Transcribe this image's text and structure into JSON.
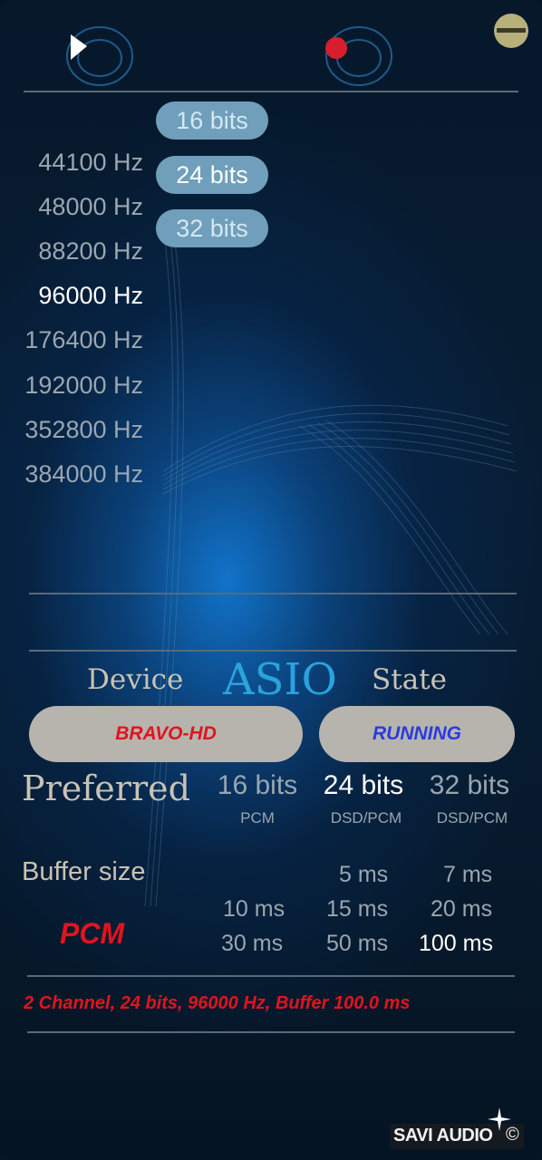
{
  "transport": {
    "play_icon": "play-icon",
    "record_icon": "record-icon",
    "minimize_icon": "minimize-icon"
  },
  "sample_rates": [
    {
      "label": "44100 Hz",
      "selected": false
    },
    {
      "label": "48000 Hz",
      "selected": false
    },
    {
      "label": "88200 Hz",
      "selected": false
    },
    {
      "label": "96000 Hz",
      "selected": true
    },
    {
      "label": "176400 Hz",
      "selected": false
    },
    {
      "label": "192000 Hz",
      "selected": false
    },
    {
      "label": "352800 Hz",
      "selected": false
    },
    {
      "label": "384000 Hz",
      "selected": false
    }
  ],
  "bit_depths": [
    {
      "label": "16 bits",
      "selected": false
    },
    {
      "label": "24 bits",
      "selected": true
    },
    {
      "label": "32 bits",
      "selected": false
    }
  ],
  "device": {
    "label": "Device",
    "value": "BRAVO-HD",
    "value_color": "#e0141e"
  },
  "asio": {
    "label": "ASIO",
    "color": "#2aa3dd"
  },
  "state": {
    "label": "State",
    "value": "RUNNING",
    "value_color": "#2a3bde"
  },
  "preferred": {
    "label": "Preferred",
    "options": [
      {
        "bits": "16 bits",
        "format": "PCM",
        "selected": false
      },
      {
        "bits": "24 bits",
        "format": "DSD/PCM",
        "selected": true
      },
      {
        "bits": "32 bits",
        "format": "DSD/PCM",
        "selected": false
      }
    ]
  },
  "buffer": {
    "label": "Buffer size",
    "mode": "PCM",
    "rows": [
      [
        "",
        "5 ms",
        "7 ms"
      ],
      [
        "10 ms",
        "15 ms",
        "20 ms"
      ],
      [
        "30 ms",
        "50 ms",
        "100 ms"
      ]
    ],
    "selected": "100 ms"
  },
  "status_line": "2 Channel, 24 bits, 96000 Hz, Buffer 100.0 ms",
  "logo": {
    "text": "SAVI AUDIO",
    "copyright": "©"
  },
  "colors": {
    "accent_red": "#e0141e",
    "accent_blue": "#2a3bde",
    "pill_blue": "#6f9fbb",
    "pill_grey": "#b7b4ae"
  }
}
